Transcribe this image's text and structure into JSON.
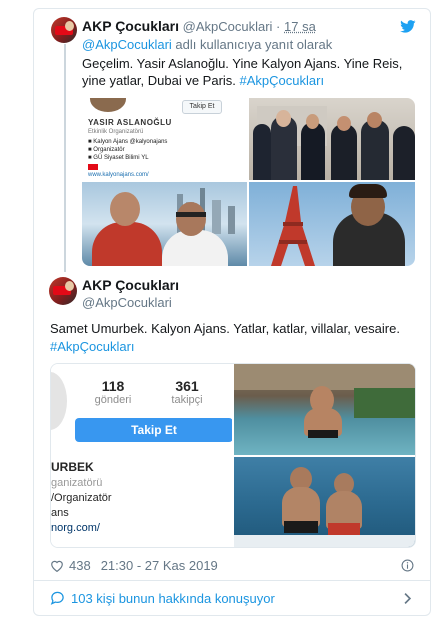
{
  "tweet1": {
    "name": "AKP Çocukları",
    "handle": "@AkpCocuklari",
    "separator": "·",
    "time": "17 sa",
    "reply_prefix": "@AkpCocuklari",
    "reply_suffix": " adlı kullanıcıya yanıt olarak",
    "text": "Geçelim. Yasir Aslanoğlu. Yine Kalyon Ajans. Yine Reis, yine yatlar, Dubai ve Paris. ",
    "hashtag": "#AkpÇocukları",
    "profile_card": {
      "name": "YASIR ASLANOĞLU",
      "subtitle": "Etkinlik Organizatörü",
      "lines": [
        "Kalyon Ajans @kalyonajans",
        "Organizatör",
        "GÜ Siyaset Bilimi YL"
      ],
      "url": "www.kalyonajans.com/",
      "follow_button": "Takip Et"
    }
  },
  "tweet2": {
    "name": "AKP Çocukları",
    "handle": "@AkpCocuklari",
    "text": "Samet Umurbek. Kalyon Ajans. Yatlar, katlar, villalar, vesaire.",
    "hashtag": "#AkpÇocukları",
    "profile_crop": {
      "posts_count": "118",
      "posts_label": "gönderi",
      "followers_count": "361",
      "followers_label": "takipçi",
      "follow_button": "Takip Et",
      "name_fragment": "URBEK",
      "line1": "ganizatörü",
      "line2": "/Organizatör",
      "line3": "ans",
      "line4": "norg.com/"
    }
  },
  "footer": {
    "likes": "438",
    "timestamp": "21:30 - 27 Kas 2019"
  },
  "conversation": {
    "label": "103 kişi bunun hakkında konuşuyor"
  },
  "colors": {
    "accent": "#1b95e0",
    "twitter_blue": "#1da1f2",
    "muted": "#657786",
    "border": "#e1e8ed"
  },
  "icons": [
    "twitter-bird-icon",
    "heart-icon",
    "info-icon",
    "comment-icon",
    "chevron-right-icon"
  ]
}
